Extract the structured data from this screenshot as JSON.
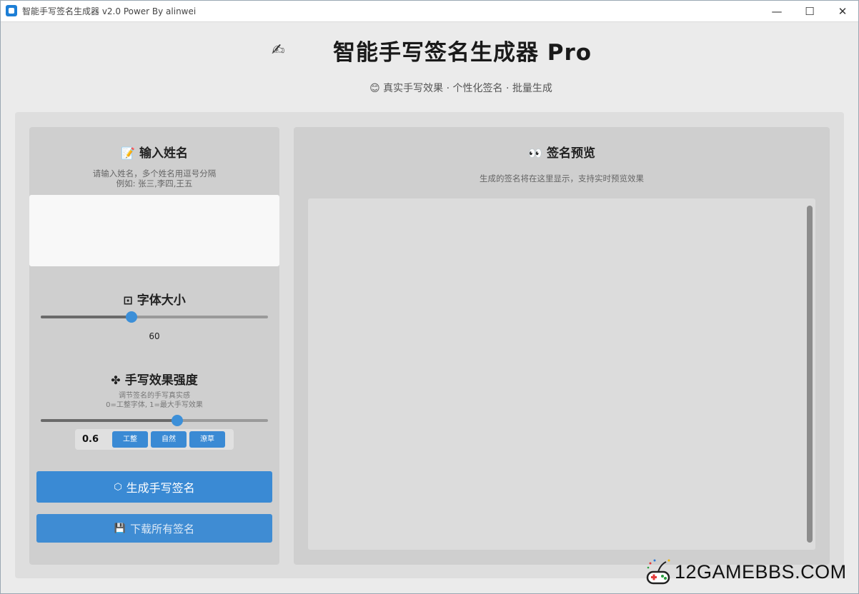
{
  "window": {
    "title": "智能手写签名生成器 v2.0 Power By alinwei",
    "minimize": "—",
    "maximize": "☐",
    "close": "✕"
  },
  "header": {
    "icon": "✍",
    "title": "智能手写签名生成器 Pro",
    "subtitle": "😊 真实手写效果 · 个性化签名 · 批量生成"
  },
  "name_section": {
    "icon": "📝",
    "title": "输入姓名",
    "hint_line1": "请输入姓名，多个姓名用逗号分隔",
    "hint_line2": "例如: 张三,李四,王五",
    "input_value": ""
  },
  "font_size": {
    "icon": "⊡",
    "title": "字体大小",
    "value": 60,
    "value_label": "60",
    "min": 20,
    "max": 120
  },
  "handwriting": {
    "icon": "✤",
    "title": "手写效果强度",
    "hint_line1": "调节签名的手写真实感",
    "hint_line2": "0=工整字体, 1=最大手写效果",
    "value": 0.6,
    "value_label": "0.6",
    "presets": [
      "工整",
      "自然",
      "潦草"
    ]
  },
  "actions": {
    "generate_icon": "⬡",
    "generate_label": "生成手写签名",
    "download_icon": "💾",
    "download_label": "下载所有签名"
  },
  "preview": {
    "icon": "👀",
    "title": "签名预览",
    "hint": "生成的签名将在这里显示，支持实时预览效果"
  },
  "watermark": {
    "text": "12GAMEBBS.COM"
  },
  "colors": {
    "accent": "#3a8ad4",
    "panel": "#cfcfcf",
    "background": "#ebebeb"
  }
}
